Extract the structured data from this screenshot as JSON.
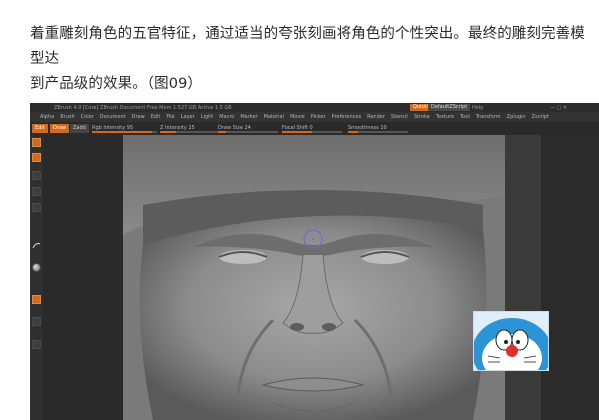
{
  "article": {
    "line1": "着重雕刻角色的五官特征，通过适当的夸张刻画将角色的个性突出。最终的雕刻完善模型达",
    "line2": "到产品级的效果。（图09）"
  },
  "zbrush": {
    "title_menu": "ZBrush  4.0 [Core]   ZBrush Document   Free Mem 1.527 GB  Active 1.5 GB",
    "quicksave": "QuickSave",
    "default_script": "DefaultZScript",
    "help": "Help",
    "menus": [
      "Alpha",
      "Brush",
      "Color",
      "Document",
      "Draw",
      "Edit",
      "File",
      "Layer",
      "Light",
      "Macro",
      "Marker",
      "Material",
      "Movie",
      "Picker",
      "Preferences",
      "Render",
      "Stencil",
      "Stroke",
      "Texture",
      "Tool",
      "Transform",
      "Zplugin",
      "Zscript"
    ],
    "toolbar": {
      "edit": "Edit",
      "draw": "Draw",
      "rgb_intensity": "Rgb Intensity 95",
      "z_intensity": "Z Intensity 25",
      "draw_size": "Draw Size 24",
      "focal_shift": "Focal Shift 0",
      "smoothness": "Smoothness 10"
    },
    "zadd": "Zadd",
    "zsub": "Zsub"
  },
  "colors": {
    "accent_orange": "#d5691b",
    "ui_dark": "#2c2c2c",
    "viewport_gray": "#7c7c7c"
  },
  "icons": [
    "brush-tool-icon",
    "move-icon",
    "scale-icon",
    "rotate-icon",
    "stroke-icon",
    "material-sphere-icon",
    "color-swatch-icon",
    "doraemon-image"
  ]
}
